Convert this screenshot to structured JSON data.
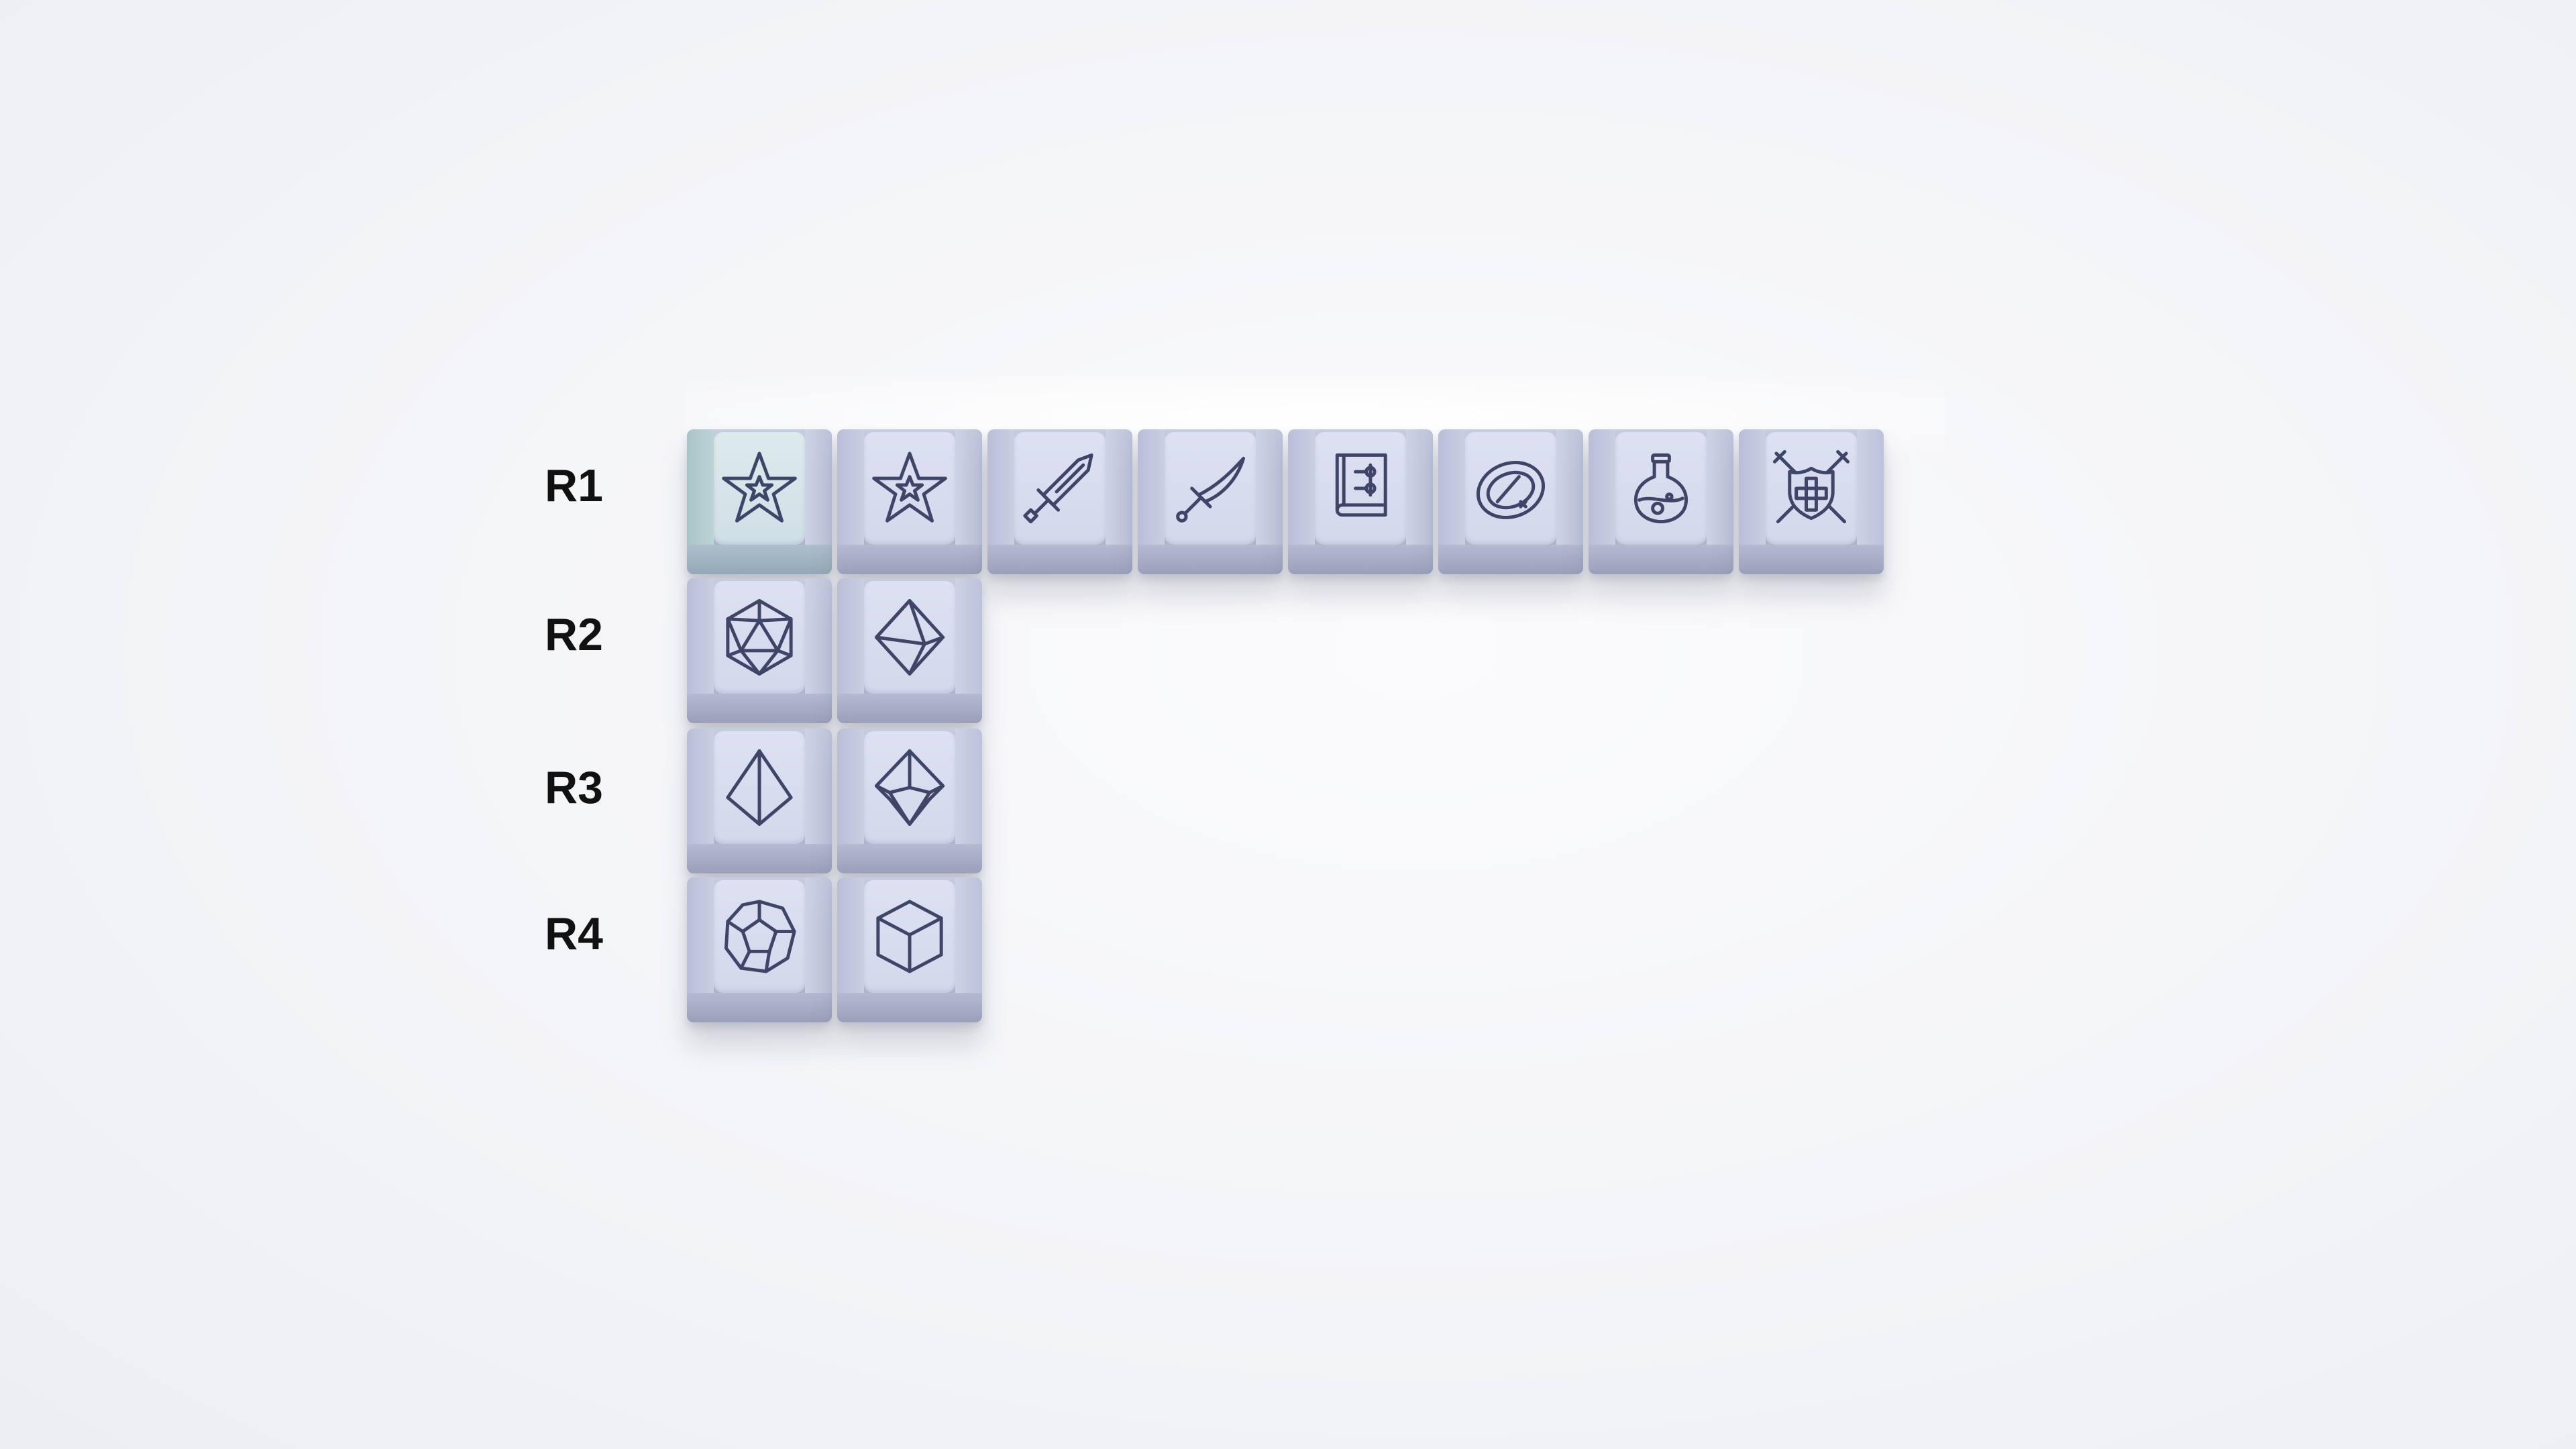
{
  "row_labels": [
    "R1",
    "R2",
    "R3",
    "R4"
  ],
  "keys": {
    "r1": [
      "star-icon",
      "star-icon",
      "sword-icon",
      "scimitar-icon",
      "spellbook-icon",
      "ring-icon",
      "potion-icon",
      "shield-crossed-swords-icon"
    ],
    "r2": [
      "d20-icon",
      "d8-icon"
    ],
    "r3": [
      "d4-icon",
      "d10-icon"
    ],
    "r4": [
      "d12-icon",
      "d6-icon"
    ]
  },
  "colors": {
    "keycap_top": "#d6dbee",
    "keycap_accent_top": "#d5e5ea",
    "legend": "#3e4566",
    "background": "#f3f4f7"
  }
}
